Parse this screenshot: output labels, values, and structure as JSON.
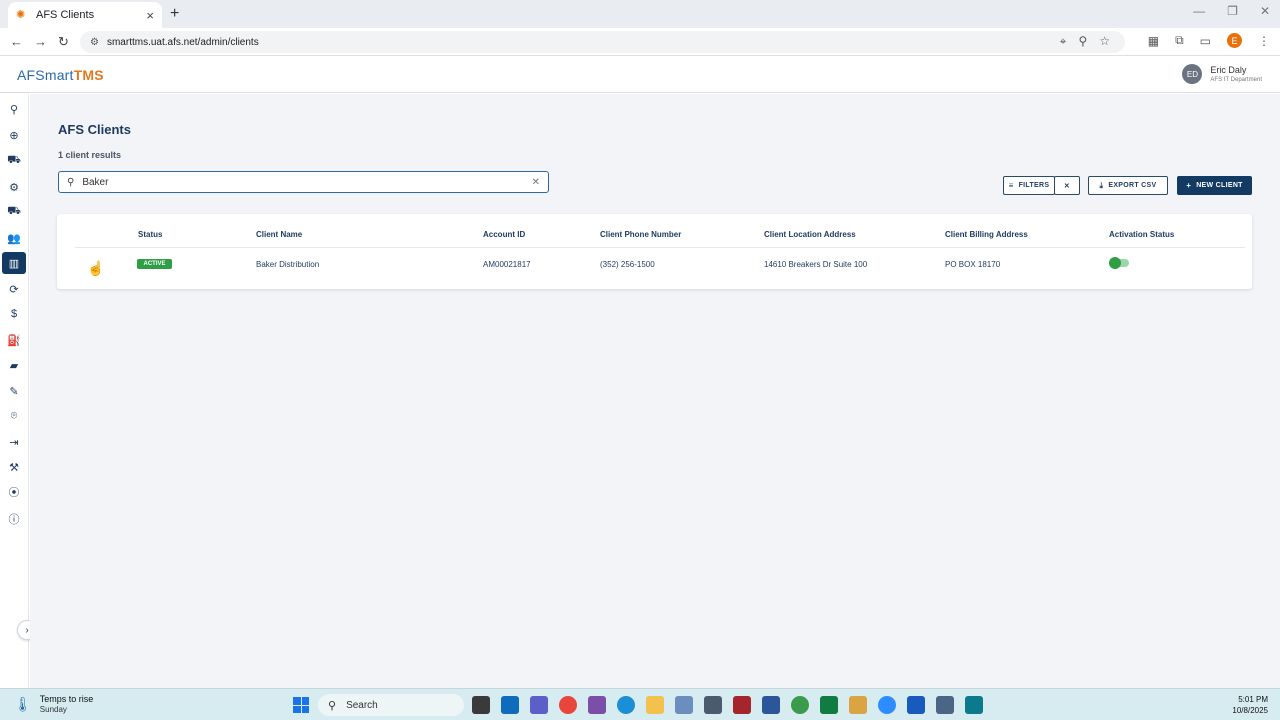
{
  "browser": {
    "tab_title": "AFS Clients",
    "url": "smarttms.uat.afs.net/admin/clients",
    "profile_initial": "E"
  },
  "header": {
    "brand_part1": "AFSmart",
    "brand_part2": "TMS",
    "user_initials": "ED",
    "user_name": "Eric Daly",
    "user_department": "AFS IT Department"
  },
  "page": {
    "title": "AFS Clients",
    "result_count": "1 client results",
    "search_value": "Baker"
  },
  "toolbar": {
    "filters_label": "FILTERS",
    "export_label": "EXPORT CSV",
    "new_client_label": "NEW CLIENT"
  },
  "table": {
    "columns": [
      "Status",
      "Client Name",
      "Account ID",
      "Client Phone Number",
      "Client Location Address",
      "Client Billing Address",
      "Activation Status"
    ],
    "rows": [
      {
        "status": "ACTIVE",
        "client_name": "Baker Distribution",
        "account_id": "AM00021817",
        "phone": "(352) 256-1500",
        "location_address": "14610 Breakers Dr Suite 100",
        "billing_address": "PO BOX 18170",
        "activation_on": true
      }
    ]
  },
  "sidebar": {
    "items": [
      "search-icon",
      "zoom-search-icon",
      "truck-icon",
      "gear-icon",
      "delivery-truck-icon",
      "users-icon",
      "building-icon",
      "sync-icon",
      "dollar-icon",
      "fuel-icon",
      "folder-icon",
      "edit-document-icon",
      "location-pin-icon",
      "export-icon",
      "hammer-icon",
      "antenna-icon",
      "info-icon"
    ],
    "active_index": 6
  },
  "taskbar": {
    "weather_title": "Temps to rise",
    "weather_sub": "Sunday",
    "search_placeholder": "Search",
    "time": "5:01 PM",
    "date": "10/8/2025"
  },
  "colors": {
    "primary": "#123a63",
    "accent_orange": "#e07a1f",
    "active_green": "#2f9e44"
  }
}
